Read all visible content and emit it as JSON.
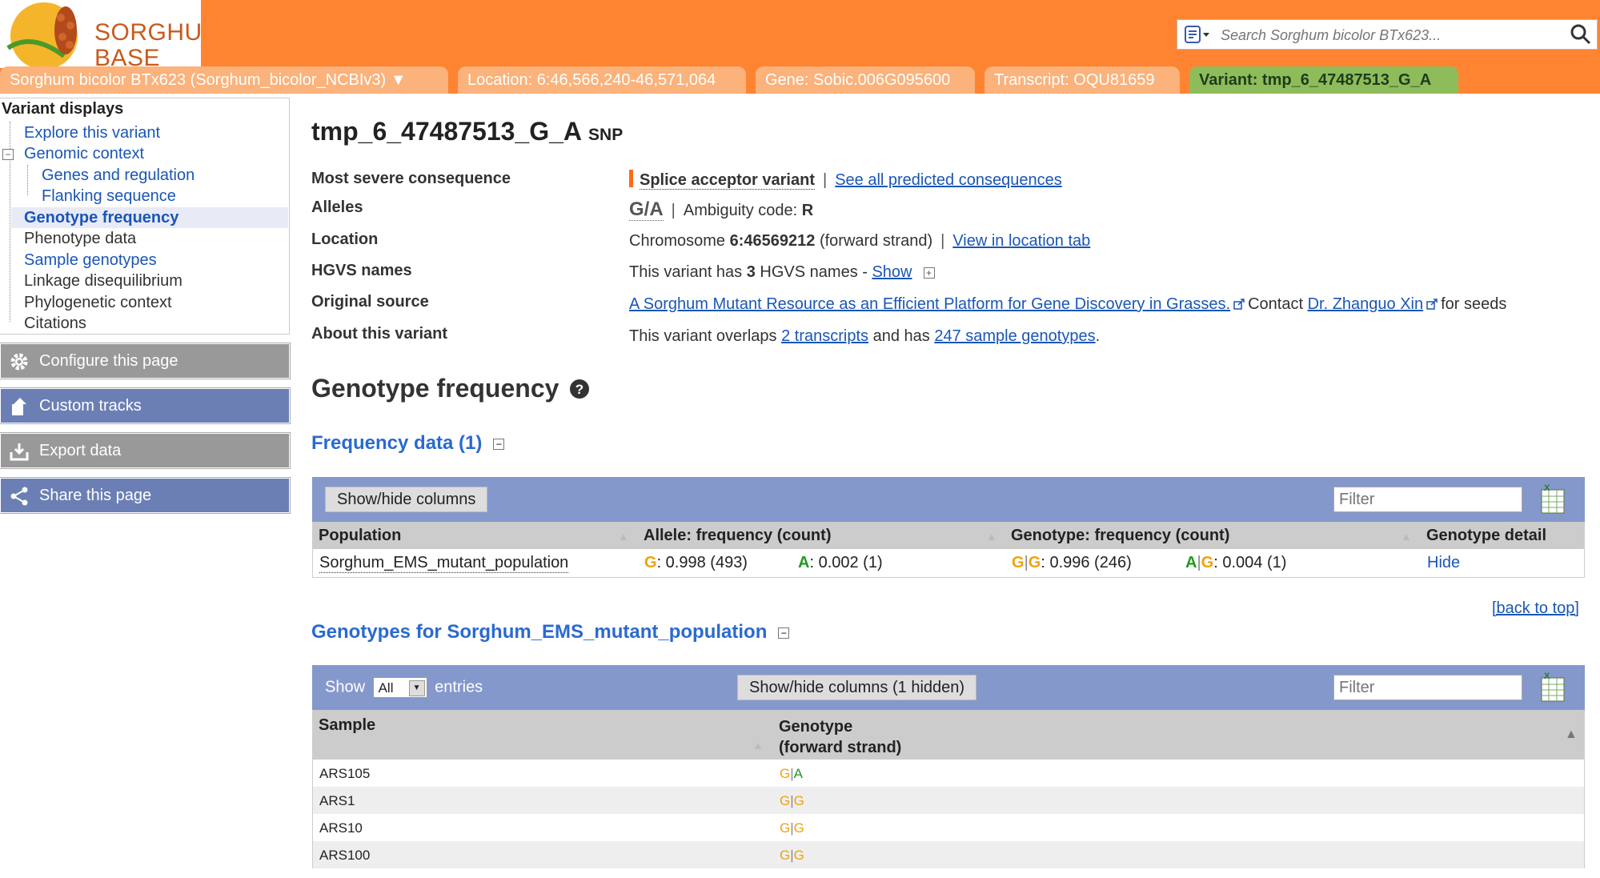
{
  "header": {
    "logo_text_line1": "SORGHUM",
    "logo_text_line2": "BASE",
    "search_placeholder": "Search Sorghum bicolor BTx623...",
    "tabs": [
      {
        "label": "Sorghum bicolor BTx623 (Sorghum_bicolor_NCBIv3) ▼"
      },
      {
        "label": "Location: 6:46,566,240-46,571,064"
      },
      {
        "label": "Gene: Sobic.006G095600"
      },
      {
        "label": "Transcript: OQU81659"
      },
      {
        "label": "Variant: tmp_6_47487513_G_A"
      }
    ]
  },
  "sidebar": {
    "title": "Variant displays",
    "items": [
      {
        "label": "Explore this variant"
      },
      {
        "label": "Genomic context"
      },
      {
        "label": "Genes and regulation"
      },
      {
        "label": "Flanking sequence"
      },
      {
        "label": "Genotype frequency"
      },
      {
        "label": "Phenotype data"
      },
      {
        "label": "Sample genotypes"
      },
      {
        "label": "Linkage disequilibrium"
      },
      {
        "label": "Phylogenetic context"
      },
      {
        "label": "Citations"
      }
    ],
    "buttons": [
      {
        "label": "Configure this page",
        "icon": "gear-icon"
      },
      {
        "label": "Custom tracks",
        "icon": "upload-icon"
      },
      {
        "label": "Export data",
        "icon": "download-icon"
      },
      {
        "label": "Share this page",
        "icon": "share-icon"
      }
    ]
  },
  "variant": {
    "name": "tmp_6_47487513_G_A",
    "type": "SNP",
    "fields": {
      "consequence_label": "Most severe consequence",
      "consequence_value": "Splice acceptor variant",
      "consequence_link": "See all predicted consequences",
      "alleles_label": "Alleles",
      "alleles_value": "G/A",
      "ambiguity_prefix": "Ambiguity code:",
      "ambiguity_code": "R",
      "location_label": "Location",
      "location_prefix": "Chromosome",
      "location_value": "6:46569212",
      "location_suffix": "(forward strand)",
      "location_link": "View in location tab",
      "hgvs_label": "HGVS names",
      "hgvs_prefix": "This variant has",
      "hgvs_count": "3",
      "hgvs_suffix": "HGVS names -",
      "hgvs_link": "Show",
      "source_label": "Original source",
      "source_link": "A Sorghum Mutant Resource as an Efficient Platform for Gene Discovery in Grasses.",
      "source_contact_prefix": "Contact",
      "source_contact_link": "Dr. Zhanguo Xin",
      "source_contact_suffix": "for seeds",
      "about_label": "About this variant",
      "about_prefix": "This variant overlaps",
      "about_link1": "2 transcripts",
      "about_mid": "and has",
      "about_link2": "247 sample genotypes",
      "about_suffix": "."
    }
  },
  "genotype_frequency": {
    "title": "Genotype frequency",
    "frequency_section": {
      "title": "Frequency data (1)",
      "show_hide_label": "Show/hide columns",
      "filter_placeholder": "Filter",
      "columns": [
        "Population",
        "Allele: frequency (count)",
        "Genotype: frequency (count)",
        "Genotype detail"
      ],
      "row": {
        "population": "Sorghum_EMS_mutant_population",
        "allele1": "G",
        "allele1_freq": ": 0.998 (493)",
        "allele2": "A",
        "allele2_freq": ": 0.002 (1)",
        "gt1_a": "G",
        "gt1_b": "G",
        "gt1_freq": ": 0.996 (246)",
        "gt2_a": "A",
        "gt2_b": "G",
        "gt2_freq": ": 0.004 (1)",
        "detail": "Hide"
      },
      "back_to_top": "[back to top]"
    },
    "genotypes_section": {
      "title": "Genotypes for Sorghum_EMS_mutant_population",
      "show_label": "Show",
      "show_value": "All",
      "entries_label": "entries",
      "show_hide_label": "Show/hide columns (1 hidden)",
      "filter_placeholder": "Filter",
      "col_sample": "Sample",
      "col_genotype_line1": "Genotype",
      "col_genotype_line2": "(forward strand)",
      "rows": [
        {
          "sample": "ARS105",
          "a1": "G",
          "a2": "A"
        },
        {
          "sample": "ARS1",
          "a1": "G",
          "a2": "G"
        },
        {
          "sample": "ARS10",
          "a1": "G",
          "a2": "G"
        },
        {
          "sample": "ARS100",
          "a1": "G",
          "a2": "G"
        }
      ]
    }
  },
  "colors": {
    "header_orange": "#fe8432",
    "tab_inactive": "#fbb27b",
    "tab_active": "#8fbc5b",
    "table_bar": "#8598cc",
    "link_blue": "#1a56b6",
    "allele_g": "#f0a30a",
    "allele_a": "#1e9a1e"
  }
}
